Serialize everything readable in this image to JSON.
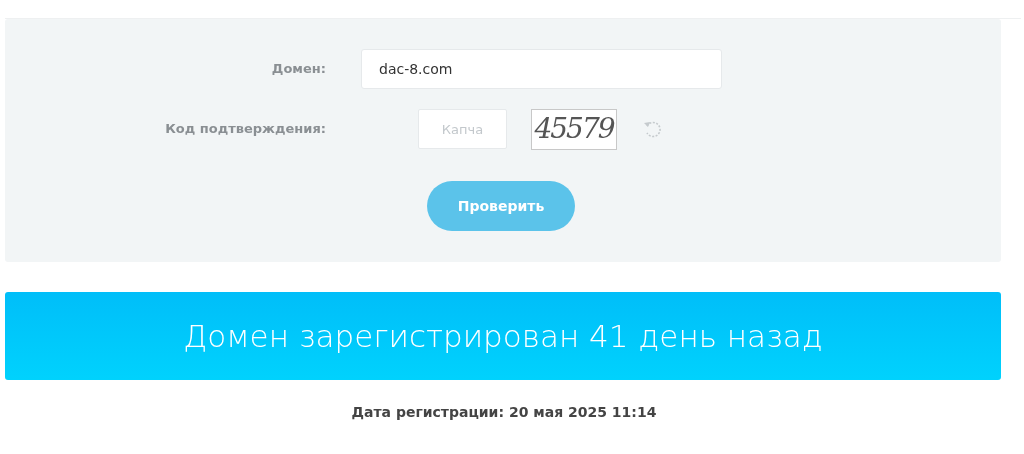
{
  "form": {
    "domain_label": "Домен:",
    "domain_value": "dac-8.com",
    "code_label": "Код подтверждения:",
    "captcha_placeholder": "Капча",
    "captcha_image_text": "45579",
    "submit": "Проверить"
  },
  "result": {
    "banner": "Домен зарегистрирован 41 день назад",
    "registration_date": "Дата регистрации: 20 мая 2025 11:14"
  }
}
